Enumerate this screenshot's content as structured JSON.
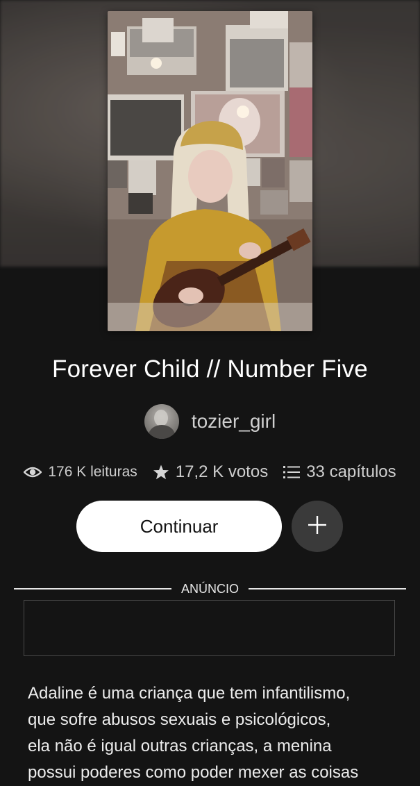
{
  "story": {
    "title": "Forever Child // Number Five",
    "author": "tozier_girl"
  },
  "stats": {
    "reads": "176 K leituras",
    "votes": "17,2 K votos",
    "chapters": "33 capítulos"
  },
  "actions": {
    "continue_label": "Continuar",
    "add_label": "+"
  },
  "ad": {
    "label": "ANÚNCIO"
  },
  "description": {
    "lines": [
      "Adaline é uma criança que tem infantilismo,",
      "que sofre abusos sexuais e psicológicos,",
      "ela não é igual outras crianças, a menina",
      "possui poderes como poder mexer as coisas"
    ]
  },
  "colors": {
    "background": "#141414",
    "button_primary": "#ffffff",
    "button_secondary": "#3a3a3a",
    "text_muted": "#cfcfcf"
  },
  "icons": {
    "reads": "eye-icon",
    "votes": "star-icon",
    "chapters": "list-icon",
    "add": "plus-icon"
  }
}
